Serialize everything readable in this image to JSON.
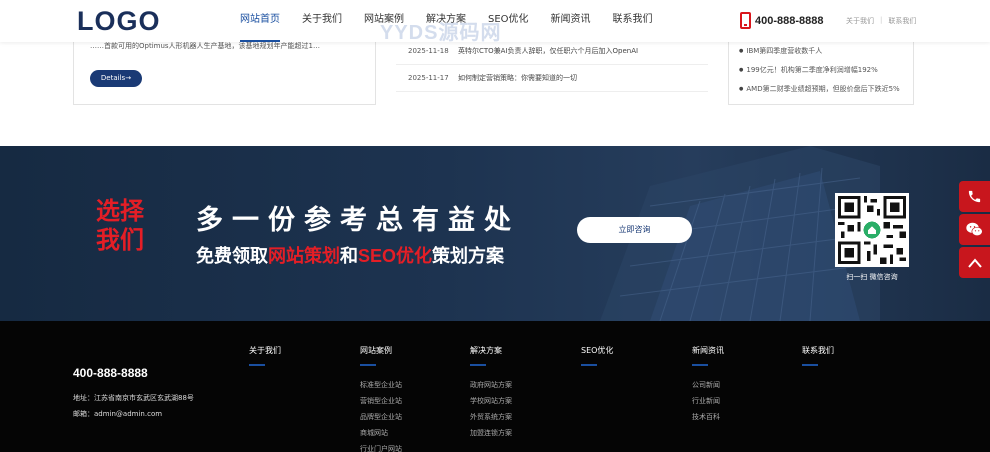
{
  "header": {
    "logo": "LOGO",
    "nav": [
      "网站首页",
      "关于我们",
      "网站案例",
      "解决方案",
      "SEO优化",
      "新闻资讯",
      "联系我们"
    ],
    "phone": "400-888-8888",
    "toplinks": [
      "关于我们",
      "联系我们"
    ]
  },
  "watermark": "YYDS源码网",
  "content": {
    "intro_text": "……首款可用的Optimus人形机器人生产基地，该基地规划年产能超过1…",
    "details_label": "Details→",
    "news": [
      {
        "date": "2025-11-18",
        "title": "英特尔CTO兼AI负责人辞职，仅任职六个月后加入OpenAI"
      },
      {
        "date": "2025-11-17",
        "title": "如何制定营销策略：你需要知道的一切"
      }
    ],
    "bullets": [
      "IBM第四季度营收数千人",
      "199亿元！机构第二季度净利润增幅192%",
      "AMD第二财季业绩超预期，但股价盘后下跌近5%"
    ]
  },
  "banner": {
    "choose": [
      "选择",
      "我们"
    ],
    "title": "多一份参考总有益处",
    "sub_prefix": "免费领取",
    "sub_red1": "网站策划",
    "sub_mid": "和",
    "sub_red2": "SEO优化",
    "sub_suffix": "策划方案",
    "button": "立即咨询",
    "qr_caption": "扫一扫 微信咨询"
  },
  "footer": {
    "phone": "400-888-8888",
    "address": "地址：江苏省南京市玄武区玄武湖88号",
    "email": "邮箱：admin@admin.com",
    "columns": [
      {
        "title": "关于我们",
        "links": []
      },
      {
        "title": "网站案例",
        "links": [
          "标准型企业站",
          "营销型企业站",
          "品牌型企业站",
          "商城网站",
          "行业门户网站"
        ]
      },
      {
        "title": "解决方案",
        "links": [
          "政府网站方案",
          "学校网站方案",
          "外贸系统方案",
          "加盟连锁方案"
        ]
      },
      {
        "title": "SEO优化",
        "links": []
      },
      {
        "title": "新闻资讯",
        "links": [
          "公司新闻",
          "行业新闻",
          "技术百科"
        ]
      },
      {
        "title": "联系我们",
        "links": []
      }
    ]
  },
  "sidefloat": [
    "phone-icon",
    "wechat-icon",
    "back-to-top-icon"
  ],
  "colors": {
    "brand_blue": "#1a3a75",
    "accent_red": "#e41e26",
    "footer_bg": "#050505"
  }
}
